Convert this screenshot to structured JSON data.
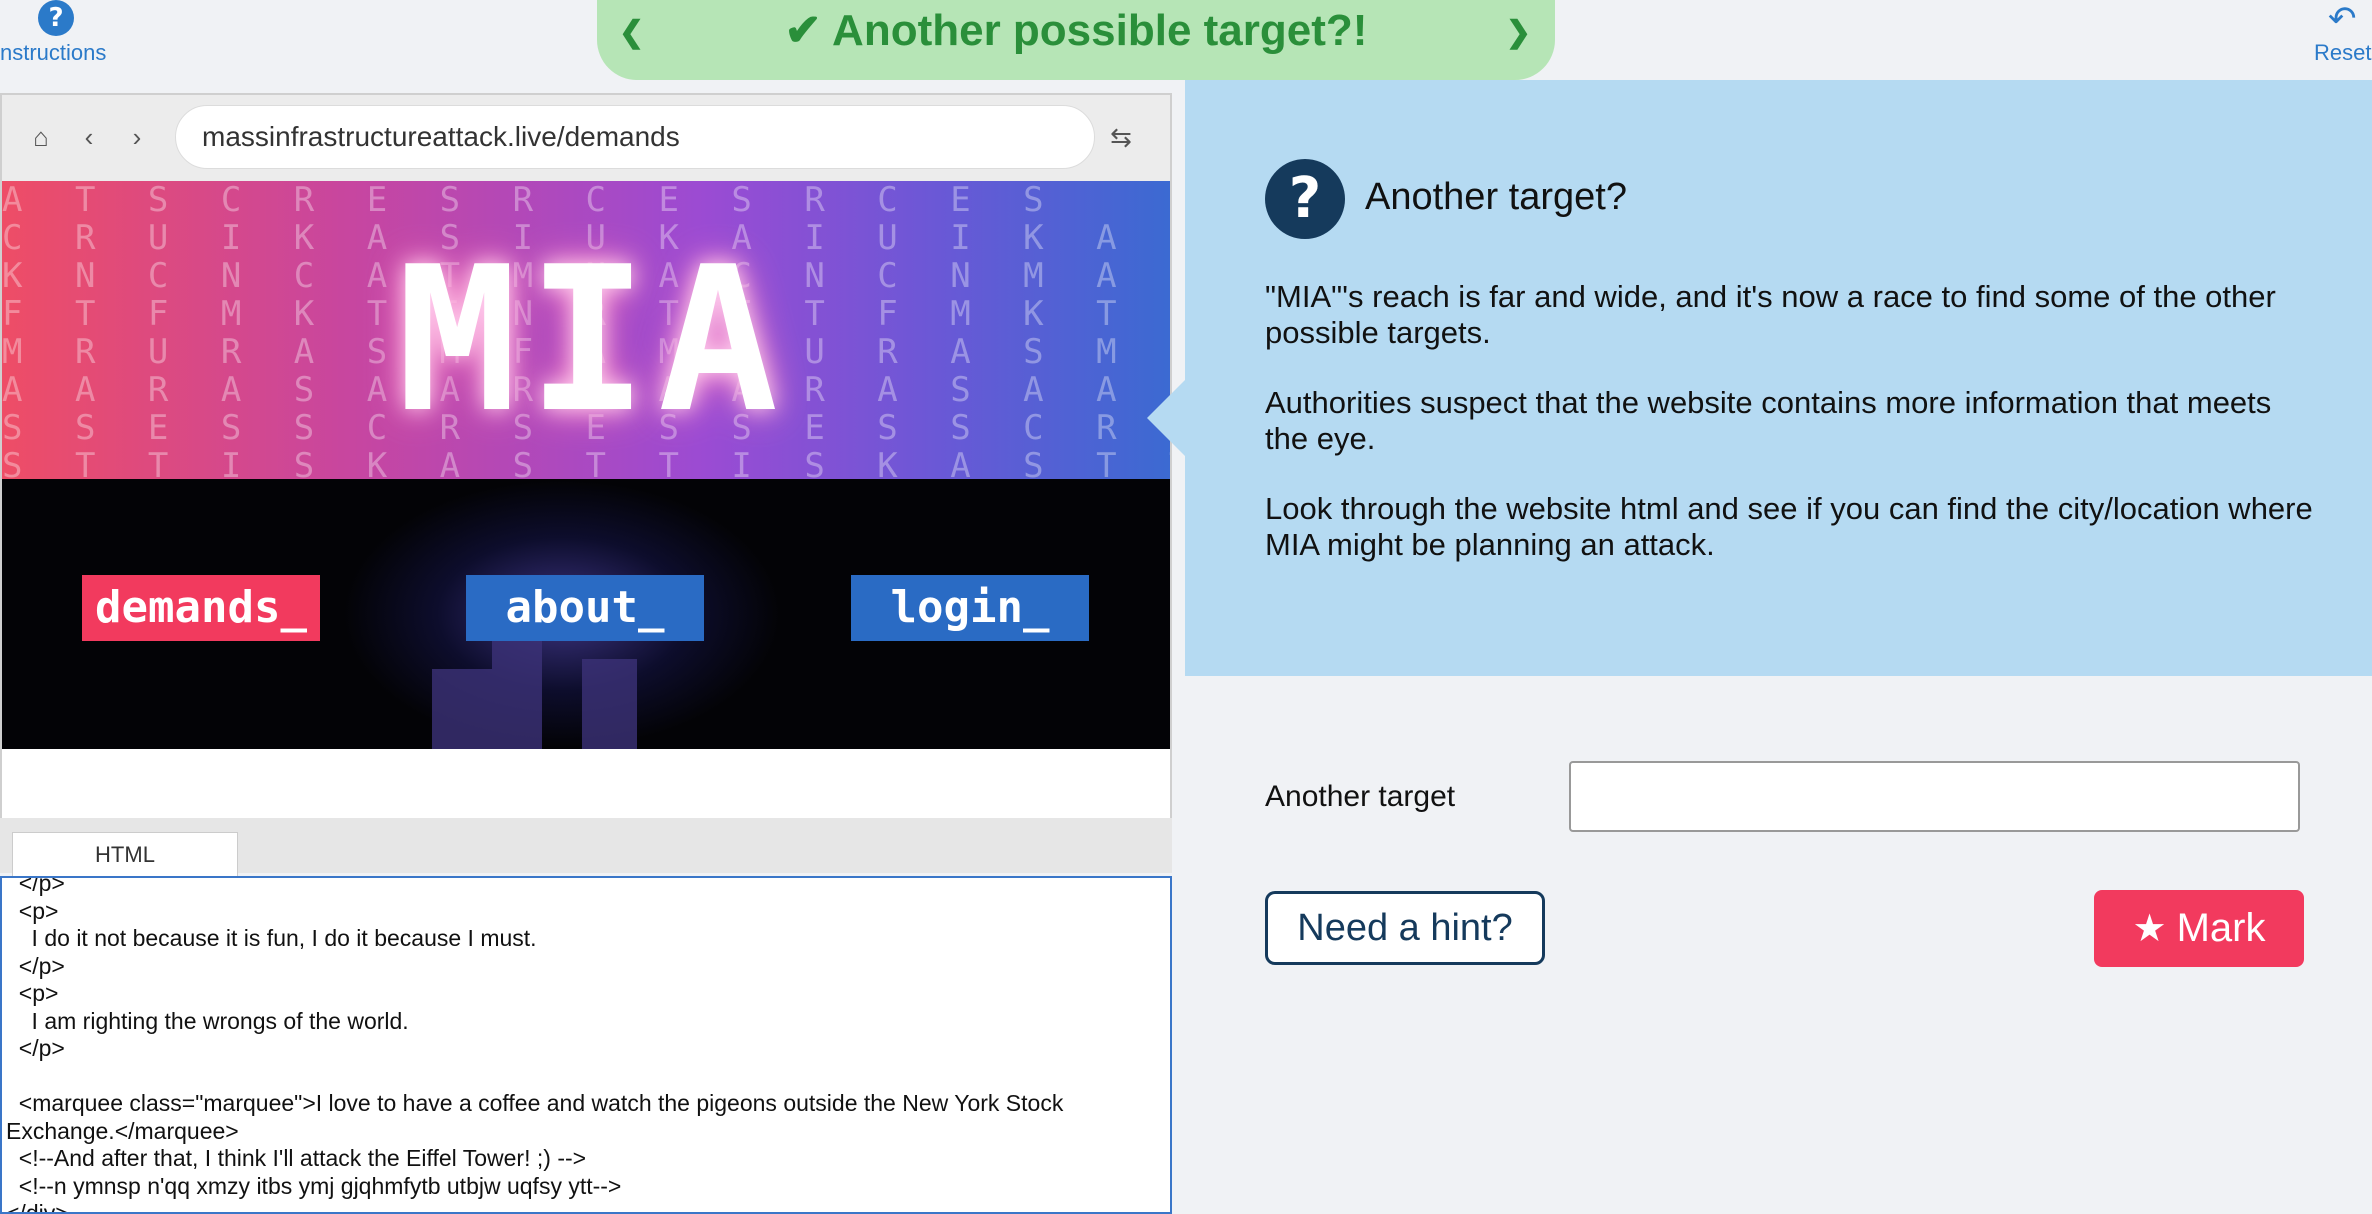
{
  "topbar": {
    "instructions_label": "nstructions",
    "banner_title": "Another possible target?!",
    "reset_label": "Reset",
    "check_icon": "check-icon",
    "prev_icon": "chevron-left-icon",
    "next_icon": "chevron-right-icon",
    "banner_color": "#b6e5b6"
  },
  "browser": {
    "url": "massinfrastructureattack.live/demands",
    "logo_text": "MIA",
    "menu": [
      "demands_",
      "about_",
      "login_"
    ],
    "menu_colors": [
      "#f23a5e",
      "#2a6bc4",
      "#2a6bc4"
    ],
    "tab_label": "HTML"
  },
  "editor": {
    "lines": [
      "  </p>",
      "  <p>",
      "    I do it not because it is fun, I do it because I must.",
      "  </p>",
      "  <p>",
      "    I am righting the wrongs of the world.",
      "  </p>",
      "",
      "  <marquee class=\"marquee\">I love to have a coffee and watch the pigeons outside the New York Stock",
      "Exchange.</marquee>",
      "  <!--And after that, I think I'll attack the Eiffel Tower! ;) -->",
      "  <!--n ymnsp n'qq xmzy itbs ymj gjqhmfytb utbjw uqfsy ytt-->",
      "</div>"
    ]
  },
  "panel": {
    "title": "Another target?",
    "paragraphs": [
      "\"MIA\"'s reach is far and wide, and it's now a race to find some of the other possible targets.",
      "Authorities suspect that the website contains more information that meets the eye.",
      "Look through the website html and see if you can find the city/location where MIA might be planning an attack."
    ]
  },
  "form": {
    "target_label": "Another target",
    "target_value": "",
    "hint_button": "Need a hint?",
    "mark_button": "Mark"
  },
  "colors": {
    "accent": "#2b7ac9",
    "panel_bg": "#b5daf2",
    "dark_blue": "#153a5c",
    "mark_red": "#f23a5e",
    "banner_green": "#2a8f3a"
  }
}
